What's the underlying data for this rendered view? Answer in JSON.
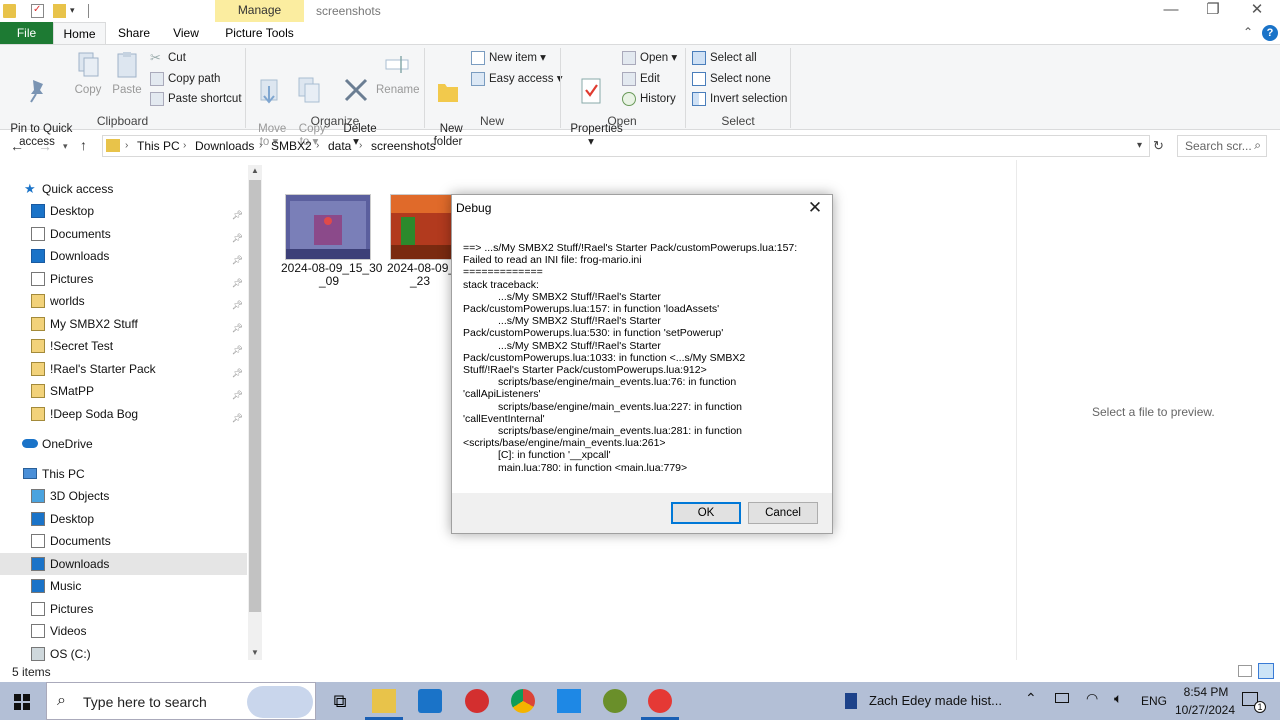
{
  "titlebar": {
    "manage_tab": "Manage",
    "title": "screenshots",
    "minimize": "—",
    "restore": "❐",
    "close": "✕"
  },
  "tabs": {
    "file": "File",
    "home": "Home",
    "share": "Share",
    "view": "View",
    "picture_tools": "Picture Tools",
    "up_arrow": "⌃",
    "help": "?"
  },
  "ribbon": {
    "clipboard": {
      "label": "Clipboard",
      "pin": "Pin to Quick\naccess",
      "copy": "Copy",
      "paste": "Paste",
      "cut": "Cut",
      "copy_path": "Copy path",
      "paste_shortcut": "Paste shortcut"
    },
    "organize": {
      "label": "Organize",
      "move_to": "Move\nto ▾",
      "copy_to": "Copy\nto ▾",
      "delete": "Delete\n▾",
      "rename": "Rename"
    },
    "new": {
      "label": "New",
      "new_folder": "New\nfolder",
      "new_item": "New item ▾",
      "easy_access": "Easy access ▾"
    },
    "open": {
      "label": "Open",
      "properties": "Properties\n▾",
      "open": "Open ▾",
      "edit": "Edit",
      "history": "History"
    },
    "select": {
      "label": "Select",
      "select_all": "Select all",
      "select_none": "Select none",
      "invert": "Invert selection"
    }
  },
  "address": {
    "crumbs": [
      "This PC",
      "Downloads",
      "SMBX2",
      "data",
      "screenshots"
    ],
    "search_placeholder": "Search scr..."
  },
  "sidebar": {
    "quick_access": "Quick access",
    "pinned": [
      "Desktop",
      "Documents",
      "Downloads",
      "Pictures",
      "worlds",
      "My SMBX2 Stuff",
      "!Secret Test",
      "!Rael's Starter Pack",
      "SMatPP",
      "!Deep Soda Bog"
    ],
    "onedrive": "OneDrive",
    "this_pc": "This PC",
    "pc_items": [
      "3D Objects",
      "Desktop",
      "Documents",
      "Downloads",
      "Music",
      "Pictures",
      "Videos",
      "OS (C:)"
    ]
  },
  "files": [
    {
      "name": "2024-08-09_15_30\n_09"
    },
    {
      "name": "2024-08-09_1\n_23"
    }
  ],
  "preview": {
    "text": "Select a file to preview."
  },
  "status": {
    "items": "5 items"
  },
  "dialog": {
    "title": "Debug",
    "body": "==> ...s/My SMBX2 Stuff/!Rael's Starter Pack/customPowerups.lua:157:\nFailed to read an INI file: frog-mario.ini\n=============\nstack traceback:\n            ...s/My SMBX2 Stuff/!Rael's Starter\nPack/customPowerups.lua:157: in function 'loadAssets'\n            ...s/My SMBX2 Stuff/!Rael's Starter\nPack/customPowerups.lua:530: in function 'setPowerup'\n            ...s/My SMBX2 Stuff/!Rael's Starter\nPack/customPowerups.lua:1033: in function <...s/My SMBX2\nStuff/!Rael's Starter Pack/customPowerups.lua:912>\n            scripts/base/engine/main_events.lua:76: in function\n'callApiListeners'\n            scripts/base/engine/main_events.lua:227: in function\n'callEventInternal'\n            scripts/base/engine/main_events.lua:281: in function\n<scripts/base/engine/main_events.lua:261>\n            [C]: in function '__xpcall'\n            main.lua:780: in function <main.lua:779>",
    "ok": "OK",
    "cancel": "Cancel"
  },
  "taskbar": {
    "search": "Type here to search",
    "news": "Zach Edey made hist...",
    "lang": "ENG",
    "time": "8:54 PM",
    "date": "10/27/2024",
    "notif_count": "1"
  }
}
